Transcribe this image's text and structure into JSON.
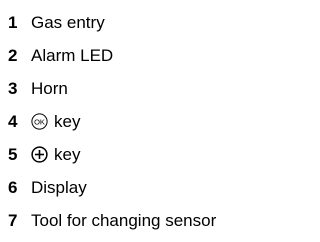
{
  "legend": {
    "items": [
      {
        "number": "1",
        "label": "Gas entry"
      },
      {
        "number": "2",
        "label": "Alarm LED"
      },
      {
        "number": "3",
        "label": "Horn"
      },
      {
        "number": "4",
        "icon": "ok-button-icon",
        "label": "key"
      },
      {
        "number": "5",
        "icon": "plus-button-icon",
        "label": "key"
      },
      {
        "number": "6",
        "label": "Display"
      },
      {
        "number": "7",
        "label": "Tool for changing sensor"
      }
    ]
  }
}
